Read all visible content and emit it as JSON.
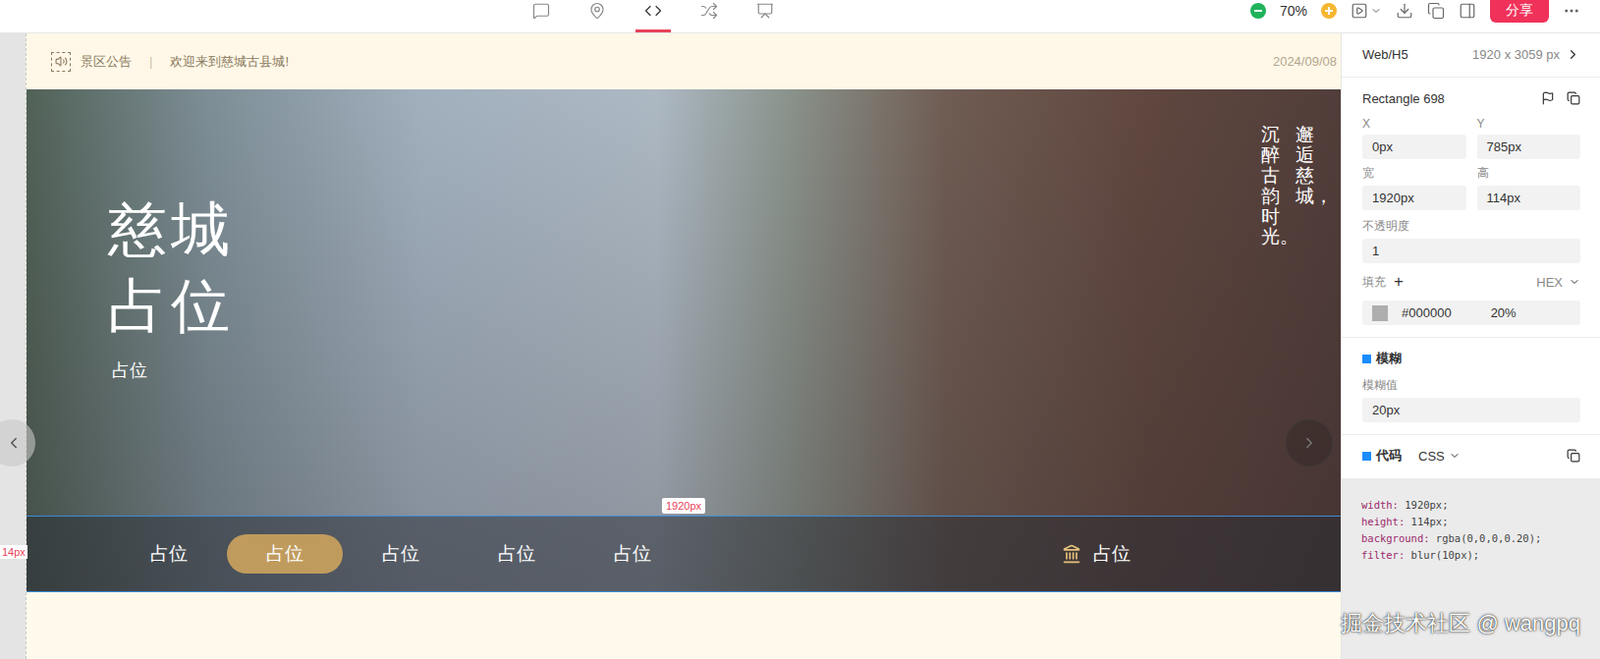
{
  "toolbar": {
    "tools": [
      {
        "kind": "comment",
        "selected": false
      },
      {
        "kind": "pin",
        "selected": false
      },
      {
        "kind": "code",
        "selected": true
      },
      {
        "kind": "flow",
        "selected": false
      },
      {
        "kind": "present",
        "selected": false
      }
    ],
    "zoom": "70%",
    "share": "分享"
  },
  "notice": {
    "label": "景区公告",
    "separator": "|",
    "text": "欢迎来到慈城古县城!",
    "date": "2024/09/08"
  },
  "hero": {
    "title_lines": [
      "慈城",
      "占位"
    ],
    "subtitle": "占位",
    "vertical_lines": [
      "邂逅慈城，",
      "沉醉古韵时光。"
    ]
  },
  "nav": {
    "items": [
      {
        "label": "占位",
        "selected": false
      },
      {
        "label": "占位",
        "selected": true
      },
      {
        "label": "占位",
        "selected": false
      },
      {
        "label": "占位",
        "selected": false
      },
      {
        "label": "占位",
        "selected": false
      }
    ],
    "extra": "占位"
  },
  "annotations": {
    "width": "1920px",
    "height": "14px"
  },
  "panel": {
    "platform": "Web/H5",
    "size": "1920 x 3059 px",
    "layer": "Rectangle 698",
    "fields": [
      {
        "label": "X",
        "value": "0px"
      },
      {
        "label": "Y",
        "value": "785px"
      },
      {
        "label": "宽",
        "value": "1920px"
      },
      {
        "label": "高",
        "value": "114px"
      }
    ],
    "opacity": {
      "label": "不透明度",
      "value": "1"
    },
    "fill": {
      "label": "填充",
      "add": "+",
      "mode": "HEX",
      "color": "#000000",
      "alpha": "20%"
    },
    "blur": {
      "title": "模糊",
      "label": "模糊值",
      "value": "20px"
    },
    "code": {
      "title": "代码",
      "lang": "CSS",
      "lines": [
        "width: 1920px;",
        "height: 114px;",
        "background: rgba(0,0,0,0.20);",
        "filter: blur(10px);"
      ]
    }
  },
  "watermark": "掘金技术社区 @ wangpq"
}
